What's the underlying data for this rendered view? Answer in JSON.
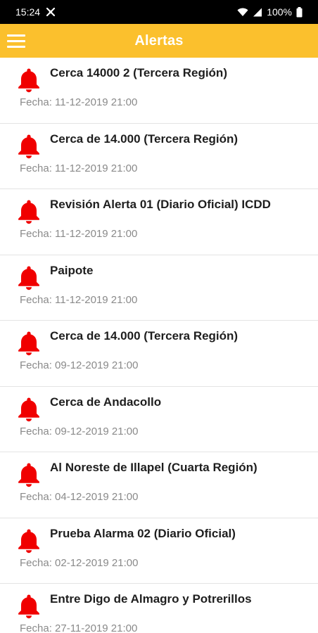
{
  "status_bar": {
    "time": "15:24",
    "battery": "100%",
    "icons": [
      "notification-icon",
      "wifi-icon",
      "signal-icon",
      "battery-icon"
    ]
  },
  "app_bar": {
    "title": "Alertas",
    "menu_icon": "hamburger-menu-icon",
    "color": "#fbc02d"
  },
  "alert_icon_color": "#f00000",
  "alerts": [
    {
      "title": "Cerca 14000 2 (Tercera Región)",
      "date": "Fecha: 11-12-2019 21:00"
    },
    {
      "title": "Cerca de 14.000 (Tercera Región)",
      "date": "Fecha: 11-12-2019 21:00"
    },
    {
      "title": "Revisión Alerta 01 (Diario Oficial) ICDD",
      "date": "Fecha: 11-12-2019 21:00"
    },
    {
      "title": "Paipote",
      "date": "Fecha: 11-12-2019 21:00"
    },
    {
      "title": "Cerca de 14.000 (Tercera Región)",
      "date": "Fecha: 09-12-2019 21:00"
    },
    {
      "title": "Cerca de Andacollo",
      "date": "Fecha: 09-12-2019 21:00"
    },
    {
      "title": "Al Noreste de Illapel (Cuarta Región)",
      "date": "Fecha: 04-12-2019 21:00"
    },
    {
      "title": "Prueba Alarma 02 (Diario Oficial)",
      "date": "Fecha: 02-12-2019 21:00"
    },
    {
      "title": "Entre Digo de Almagro y Potrerillos",
      "date": "Fecha: 27-11-2019 21:00"
    }
  ]
}
